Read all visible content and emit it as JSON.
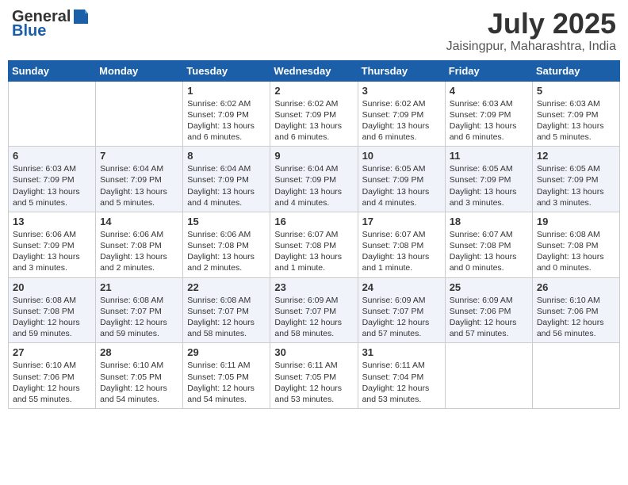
{
  "header": {
    "logo_line1": "General",
    "logo_line2": "Blue",
    "month_year": "July 2025",
    "location": "Jaisingpur, Maharashtra, India"
  },
  "calendar": {
    "days_of_week": [
      "Sunday",
      "Monday",
      "Tuesday",
      "Wednesday",
      "Thursday",
      "Friday",
      "Saturday"
    ],
    "weeks": [
      [
        {
          "day": "",
          "info": ""
        },
        {
          "day": "",
          "info": ""
        },
        {
          "day": "1",
          "info": "Sunrise: 6:02 AM\nSunset: 7:09 PM\nDaylight: 13 hours\nand 6 minutes."
        },
        {
          "day": "2",
          "info": "Sunrise: 6:02 AM\nSunset: 7:09 PM\nDaylight: 13 hours\nand 6 minutes."
        },
        {
          "day": "3",
          "info": "Sunrise: 6:02 AM\nSunset: 7:09 PM\nDaylight: 13 hours\nand 6 minutes."
        },
        {
          "day": "4",
          "info": "Sunrise: 6:03 AM\nSunset: 7:09 PM\nDaylight: 13 hours\nand 6 minutes."
        },
        {
          "day": "5",
          "info": "Sunrise: 6:03 AM\nSunset: 7:09 PM\nDaylight: 13 hours\nand 5 minutes."
        }
      ],
      [
        {
          "day": "6",
          "info": "Sunrise: 6:03 AM\nSunset: 7:09 PM\nDaylight: 13 hours\nand 5 minutes."
        },
        {
          "day": "7",
          "info": "Sunrise: 6:04 AM\nSunset: 7:09 PM\nDaylight: 13 hours\nand 5 minutes."
        },
        {
          "day": "8",
          "info": "Sunrise: 6:04 AM\nSunset: 7:09 PM\nDaylight: 13 hours\nand 4 minutes."
        },
        {
          "day": "9",
          "info": "Sunrise: 6:04 AM\nSunset: 7:09 PM\nDaylight: 13 hours\nand 4 minutes."
        },
        {
          "day": "10",
          "info": "Sunrise: 6:05 AM\nSunset: 7:09 PM\nDaylight: 13 hours\nand 4 minutes."
        },
        {
          "day": "11",
          "info": "Sunrise: 6:05 AM\nSunset: 7:09 PM\nDaylight: 13 hours\nand 3 minutes."
        },
        {
          "day": "12",
          "info": "Sunrise: 6:05 AM\nSunset: 7:09 PM\nDaylight: 13 hours\nand 3 minutes."
        }
      ],
      [
        {
          "day": "13",
          "info": "Sunrise: 6:06 AM\nSunset: 7:09 PM\nDaylight: 13 hours\nand 3 minutes."
        },
        {
          "day": "14",
          "info": "Sunrise: 6:06 AM\nSunset: 7:08 PM\nDaylight: 13 hours\nand 2 minutes."
        },
        {
          "day": "15",
          "info": "Sunrise: 6:06 AM\nSunset: 7:08 PM\nDaylight: 13 hours\nand 2 minutes."
        },
        {
          "day": "16",
          "info": "Sunrise: 6:07 AM\nSunset: 7:08 PM\nDaylight: 13 hours\nand 1 minute."
        },
        {
          "day": "17",
          "info": "Sunrise: 6:07 AM\nSunset: 7:08 PM\nDaylight: 13 hours\nand 1 minute."
        },
        {
          "day": "18",
          "info": "Sunrise: 6:07 AM\nSunset: 7:08 PM\nDaylight: 13 hours\nand 0 minutes."
        },
        {
          "day": "19",
          "info": "Sunrise: 6:08 AM\nSunset: 7:08 PM\nDaylight: 13 hours\nand 0 minutes."
        }
      ],
      [
        {
          "day": "20",
          "info": "Sunrise: 6:08 AM\nSunset: 7:08 PM\nDaylight: 12 hours\nand 59 minutes."
        },
        {
          "day": "21",
          "info": "Sunrise: 6:08 AM\nSunset: 7:07 PM\nDaylight: 12 hours\nand 59 minutes."
        },
        {
          "day": "22",
          "info": "Sunrise: 6:08 AM\nSunset: 7:07 PM\nDaylight: 12 hours\nand 58 minutes."
        },
        {
          "day": "23",
          "info": "Sunrise: 6:09 AM\nSunset: 7:07 PM\nDaylight: 12 hours\nand 58 minutes."
        },
        {
          "day": "24",
          "info": "Sunrise: 6:09 AM\nSunset: 7:07 PM\nDaylight: 12 hours\nand 57 minutes."
        },
        {
          "day": "25",
          "info": "Sunrise: 6:09 AM\nSunset: 7:06 PM\nDaylight: 12 hours\nand 57 minutes."
        },
        {
          "day": "26",
          "info": "Sunrise: 6:10 AM\nSunset: 7:06 PM\nDaylight: 12 hours\nand 56 minutes."
        }
      ],
      [
        {
          "day": "27",
          "info": "Sunrise: 6:10 AM\nSunset: 7:06 PM\nDaylight: 12 hours\nand 55 minutes."
        },
        {
          "day": "28",
          "info": "Sunrise: 6:10 AM\nSunset: 7:05 PM\nDaylight: 12 hours\nand 54 minutes."
        },
        {
          "day": "29",
          "info": "Sunrise: 6:11 AM\nSunset: 7:05 PM\nDaylight: 12 hours\nand 54 minutes."
        },
        {
          "day": "30",
          "info": "Sunrise: 6:11 AM\nSunset: 7:05 PM\nDaylight: 12 hours\nand 53 minutes."
        },
        {
          "day": "31",
          "info": "Sunrise: 6:11 AM\nSunset: 7:04 PM\nDaylight: 12 hours\nand 53 minutes."
        },
        {
          "day": "",
          "info": ""
        },
        {
          "day": "",
          "info": ""
        }
      ]
    ]
  }
}
